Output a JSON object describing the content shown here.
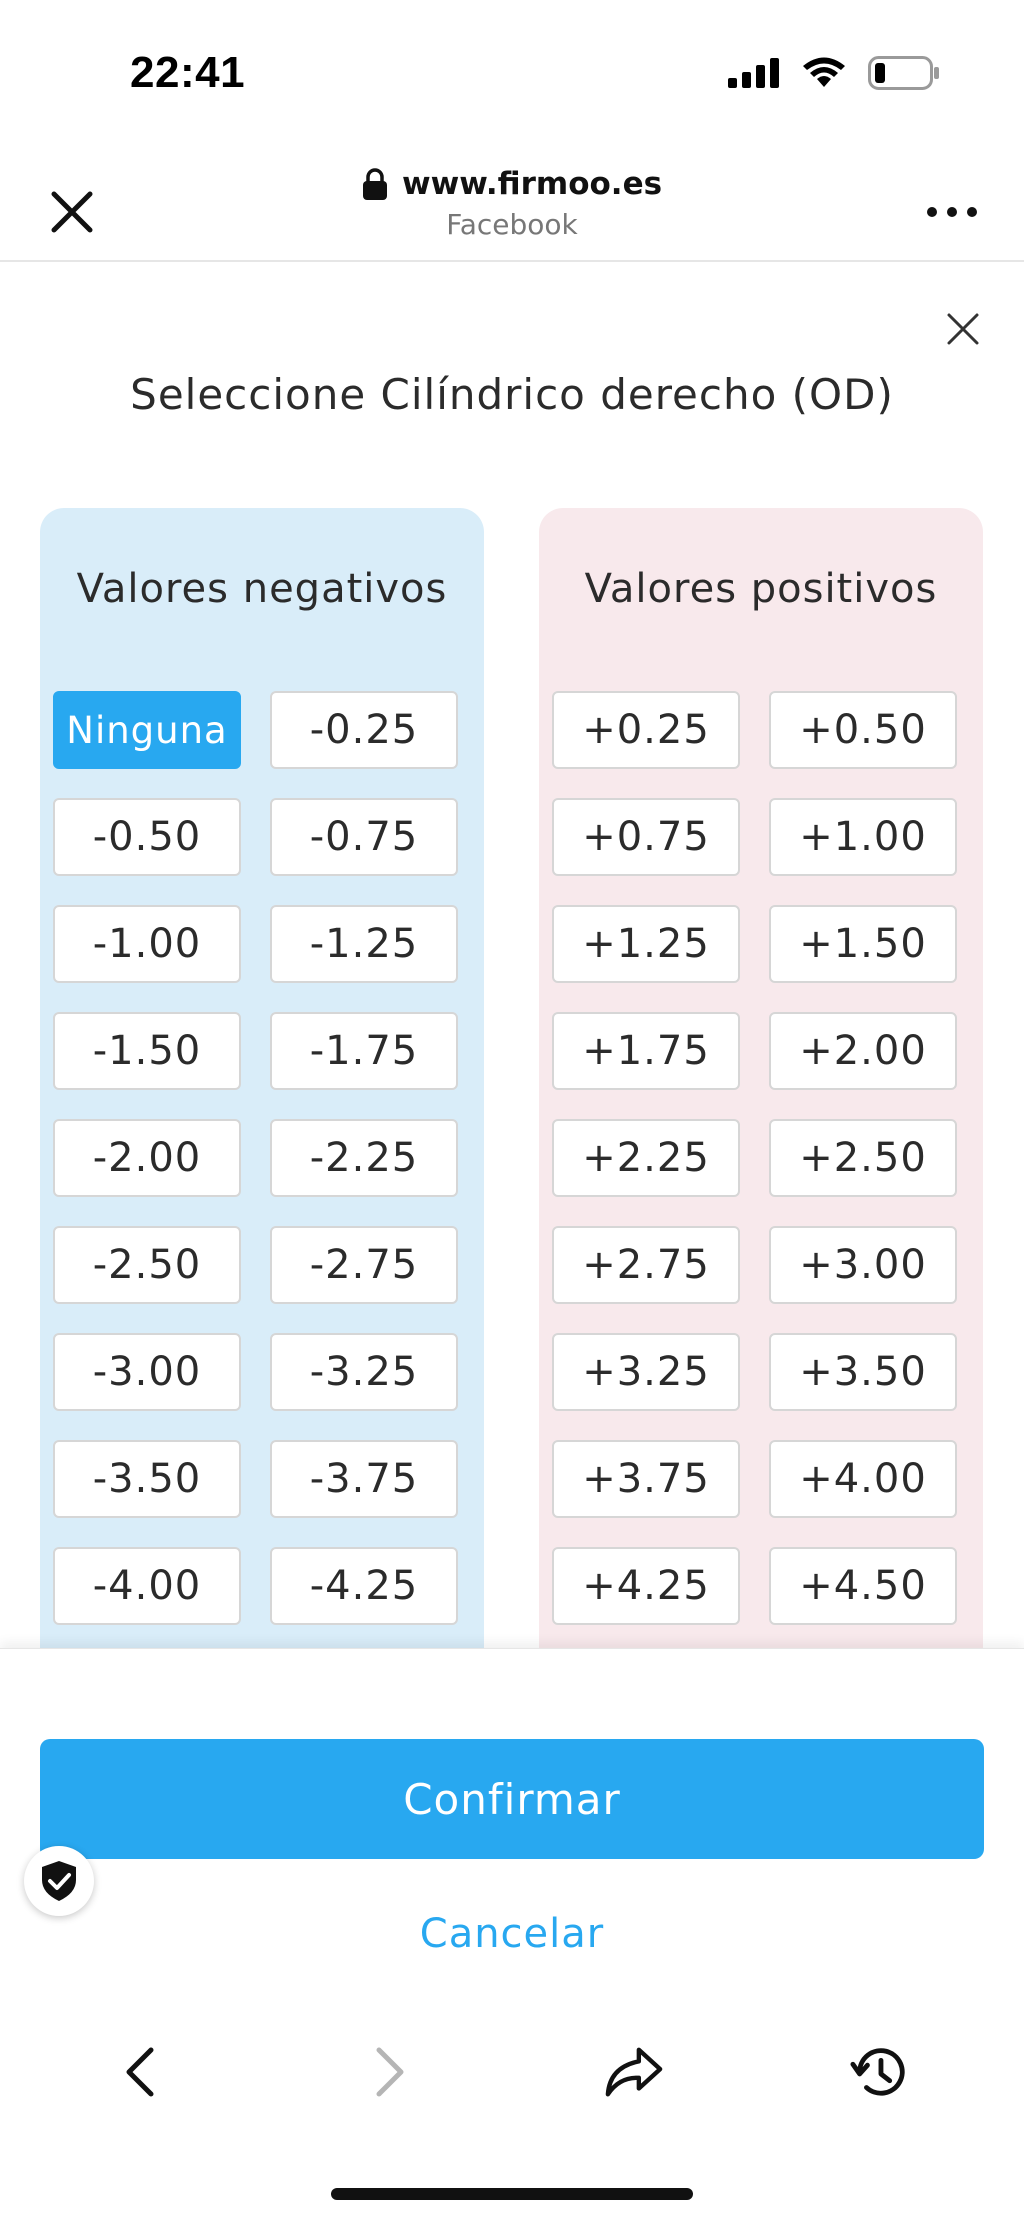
{
  "status_bar": {
    "time": "22:41"
  },
  "browser": {
    "url": "www.firmoo.es",
    "source": "Facebook"
  },
  "modal": {
    "title": "Seleccione Cilíndrico derecho (OD)",
    "selected_value": "Ninguna",
    "negative": {
      "title": "Valores negativos",
      "values": [
        "Ninguna",
        "-0.25",
        "-0.50",
        "-0.75",
        "-1.00",
        "-1.25",
        "-1.50",
        "-1.75",
        "-2.00",
        "-2.25",
        "-2.50",
        "-2.75",
        "-3.00",
        "-3.25",
        "-3.50",
        "-3.75",
        "-4.00",
        "-4.25"
      ]
    },
    "positive": {
      "title": "Valores positivos",
      "values": [
        "+0.25",
        "+0.50",
        "+0.75",
        "+1.00",
        "+1.25",
        "+1.50",
        "+1.75",
        "+2.00",
        "+2.25",
        "+2.50",
        "+2.75",
        "+3.00",
        "+3.25",
        "+3.50",
        "+3.75",
        "+4.00",
        "+4.25",
        "+4.50"
      ]
    }
  },
  "actions": {
    "confirm_label": "Confirmar",
    "cancel_label": "Cancelar"
  },
  "colors": {
    "accent": "#28a8f0",
    "negative_panel": "#d9edf9",
    "positive_panel": "#f8e9ec"
  },
  "icons": {
    "status": [
      "signal-icon",
      "wifi-icon",
      "battery-icon"
    ],
    "toolbar": [
      "back-icon",
      "forward-icon",
      "share-icon",
      "history-icon"
    ]
  }
}
